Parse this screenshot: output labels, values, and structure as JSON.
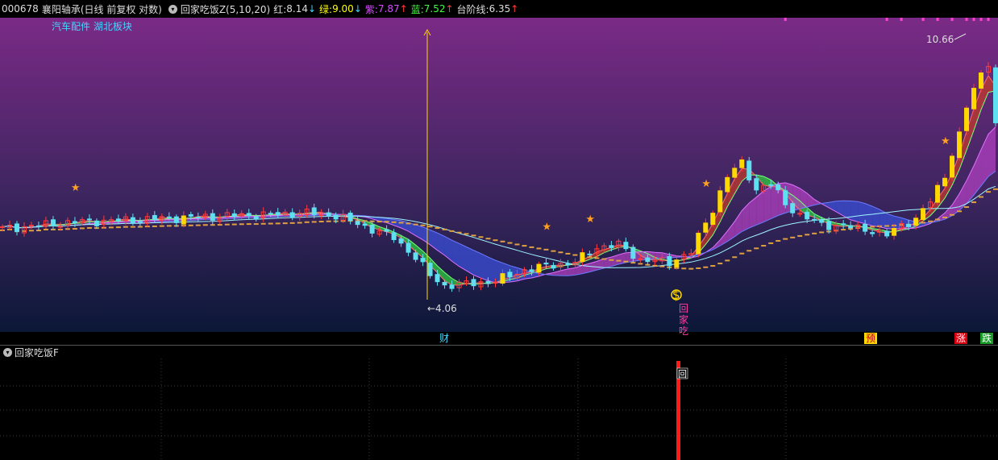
{
  "header": {
    "code": "000678",
    "name": "襄阳轴承",
    "period_info": "(日线 前复权 对数)",
    "indicator": "回家吃饭Z(5,10,20)",
    "red_label": "红:",
    "red_value": "8.14",
    "red_arrow": "↓",
    "green_label": "绿:",
    "green_value": "9.00",
    "green_arrow": "↓",
    "purple_label": "紫:",
    "purple_value": "7.87",
    "purple_arrow": "↑",
    "blue_label": "蓝:",
    "blue_value": "7.52",
    "blue_arrow": "↑",
    "step_label": "台阶线:",
    "step_value": "6.35",
    "step_arrow": "↑"
  },
  "sector": "汽车配件 湖北板块",
  "annotations": {
    "high_price": "10.66",
    "low_price": "←4.06",
    "vertical_text": [
      "回",
      "家",
      "吃"
    ]
  },
  "bottom_tags": {
    "cai": "财",
    "yu": "预",
    "zhang": "涨",
    "die": "跌"
  },
  "sub_panel": {
    "title": "回家吃饭F",
    "marker": "回"
  },
  "colors": {
    "bg_top": "#7a2a86",
    "bg_bottom": "#0a1736",
    "up": "#ff3b3b",
    "down": "#5fe0f0",
    "step_line": "#e0a040",
    "yellow": "#ffd800"
  },
  "chart_data": {
    "type": "candlestick",
    "x_range": [
      0,
      137
    ],
    "price_range": [
      3.5,
      12.2
    ],
    "log_scale": true,
    "annotated_extremes": {
      "low": 4.06,
      "high": 10.66
    },
    "close_anchors": [
      [
        0,
        5.25
      ],
      [
        10,
        5.4
      ],
      [
        18,
        5.45
      ],
      [
        25,
        5.5
      ],
      [
        32,
        5.55
      ],
      [
        38,
        5.58
      ],
      [
        42,
        5.62
      ],
      [
        46,
        5.55
      ],
      [
        50,
        5.3
      ],
      [
        54,
        5.05
      ],
      [
        57,
        4.65
      ],
      [
        59,
        4.3
      ],
      [
        61,
        4.12
      ],
      [
        64,
        4.15
      ],
      [
        68,
        4.2
      ],
      [
        72,
        4.4
      ],
      [
        76,
        4.5
      ],
      [
        79,
        4.55
      ],
      [
        82,
        4.85
      ],
      [
        85,
        4.9
      ],
      [
        88,
        4.6
      ],
      [
        92,
        4.55
      ],
      [
        95,
        4.75
      ],
      [
        98,
        5.7
      ],
      [
        100,
        6.55
      ],
      [
        102,
        6.95
      ],
      [
        104,
        6.2
      ],
      [
        106,
        6.35
      ],
      [
        108,
        5.85
      ],
      [
        110,
        5.55
      ],
      [
        113,
        5.35
      ],
      [
        116,
        5.3
      ],
      [
        119,
        5.25
      ],
      [
        122,
        5.1
      ],
      [
        124,
        5.35
      ],
      [
        126,
        5.45
      ],
      [
        128,
        5.9
      ],
      [
        130,
        6.6
      ],
      [
        132,
        7.8
      ],
      [
        133,
        8.8
      ],
      [
        135,
        10.2
      ],
      [
        136,
        10.66
      ],
      [
        137,
        8.14
      ]
    ],
    "series": [
      {
        "name": "红",
        "last": 8.14
      },
      {
        "name": "绿",
        "last": 9.0
      },
      {
        "name": "紫",
        "last": 7.87
      },
      {
        "name": "蓝",
        "last": 7.52
      },
      {
        "name": "台阶线",
        "last": 6.35
      }
    ]
  }
}
